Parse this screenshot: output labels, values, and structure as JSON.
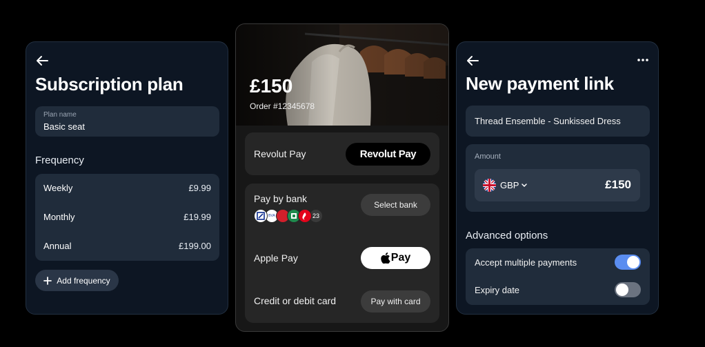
{
  "subscription": {
    "title": "Subscription plan",
    "plan_name_label": "Plan name",
    "plan_name_value": "Basic seat",
    "frequency_label": "Frequency",
    "frequencies": [
      {
        "name": "Weekly",
        "price": "£9.99"
      },
      {
        "name": "Monthly",
        "price": "£19.99"
      },
      {
        "name": "Annual",
        "price": "£199.00"
      }
    ],
    "add_frequency_label": "Add frequency"
  },
  "checkout": {
    "amount": "£150",
    "order": "Order #12345678",
    "revolut_pay_label": "Revolut Pay",
    "revolut_pay_button": "Revolut Pay",
    "pay_by_bank_label": "Pay by bank",
    "bank_more_count": "23",
    "select_bank_button": "Select bank",
    "apple_pay_label": "Apple Pay",
    "apple_pay_button": "Pay",
    "card_label": "Credit or debit card",
    "card_button": "Pay with card",
    "bank_logo_icons": [
      "deutsche-bank-icon",
      "bva-icon",
      "red-bank-icon",
      "green-bank-icon",
      "santander-icon"
    ]
  },
  "payment_link": {
    "title": "New payment link",
    "product": "Thread Ensemble - Sunkissed Dress",
    "amount_label": "Amount",
    "currency": "GBP",
    "amount_value": "£150",
    "advanced_label": "Advanced options",
    "options": [
      {
        "label": "Accept multiple payments",
        "enabled": true
      },
      {
        "label": "Expiry date",
        "enabled": false
      }
    ]
  },
  "colors": {
    "card_bg": "#0d1623",
    "field_bg": "#202c3b",
    "toggle_on": "#5a8df0",
    "toggle_off": "#6b7380"
  }
}
